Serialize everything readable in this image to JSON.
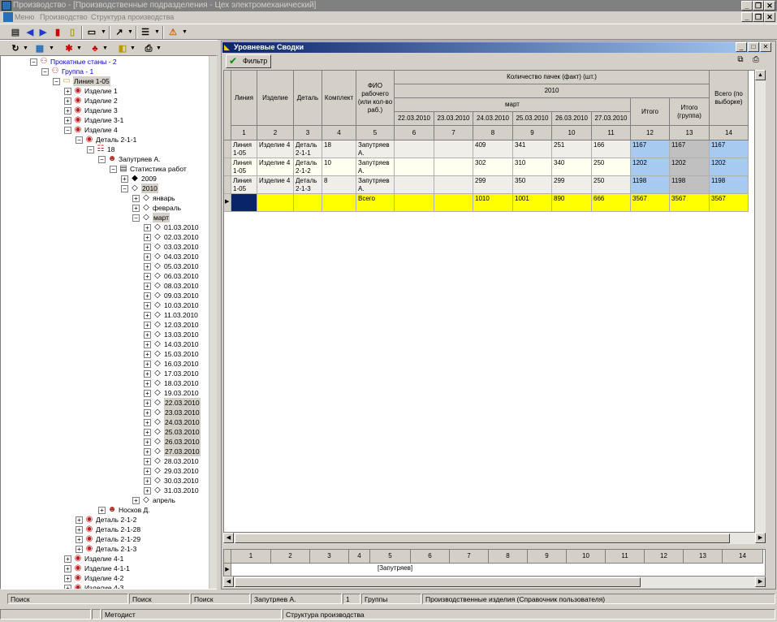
{
  "window": {
    "title": "Производство - [Производственные подразделения - Цех электромеханический]",
    "minimize": "_",
    "restore": "❐",
    "close": "✕"
  },
  "menu": {
    "items": [
      "Меню",
      "Производство",
      "Структура производства"
    ]
  },
  "tree": {
    "nodes": [
      {
        "label": "Прокатные станы - 2",
        "depth": 3,
        "icon": "org-icon",
        "exp": "-",
        "blue": true
      },
      {
        "label": "Группа - 1",
        "depth": 4,
        "icon": "org-icon",
        "exp": "-",
        "blue": true
      },
      {
        "label": "Линия 1-05",
        "depth": 5,
        "icon": "folder-icon",
        "exp": "-",
        "sel": true
      },
      {
        "label": "Изделие 1",
        "depth": 6,
        "icon": "product-icon",
        "exp": "+"
      },
      {
        "label": "Изделие 2",
        "depth": 6,
        "icon": "product-icon",
        "exp": "+"
      },
      {
        "label": "Изделие 3",
        "depth": 6,
        "icon": "product-icon",
        "exp": "+"
      },
      {
        "label": "Изделие 3-1",
        "depth": 6,
        "icon": "product-icon",
        "exp": "+"
      },
      {
        "label": "Изделие 4",
        "depth": 6,
        "icon": "product-icon",
        "exp": "-"
      },
      {
        "label": "Деталь 2-1-1",
        "depth": 7,
        "icon": "product-icon",
        "exp": "-"
      },
      {
        "label": "18",
        "depth": 8,
        "icon": "team-icon",
        "exp": "-"
      },
      {
        "label": "Запутряев А.",
        "depth": 9,
        "icon": "worker-icon",
        "exp": "-"
      },
      {
        "label": "Статистика работ",
        "depth": 10,
        "icon": "doc-icon",
        "exp": "-"
      },
      {
        "label": "2009",
        "depth": 11,
        "icon": "diamond-filled-icon",
        "exp": "+"
      },
      {
        "label": "2010",
        "depth": 11,
        "icon": "diamond-icon",
        "exp": "-",
        "sel": true
      },
      {
        "label": "январь",
        "depth": 12,
        "icon": "diamond-icon",
        "exp": "+"
      },
      {
        "label": "февраль",
        "depth": 12,
        "icon": "diamond-icon",
        "exp": "+"
      },
      {
        "label": "март",
        "depth": 12,
        "icon": "diamond-icon",
        "exp": "-",
        "sel": true
      },
      {
        "label": "01.03.2010",
        "depth": 13,
        "icon": "diamond-icon",
        "exp": "+"
      },
      {
        "label": "02.03.2010",
        "depth": 13,
        "icon": "diamond-icon",
        "exp": "+"
      },
      {
        "label": "03.03.2010",
        "depth": 13,
        "icon": "diamond-icon",
        "exp": "+"
      },
      {
        "label": "04.03.2010",
        "depth": 13,
        "icon": "diamond-icon",
        "exp": "+"
      },
      {
        "label": "05.03.2010",
        "depth": 13,
        "icon": "diamond-icon",
        "exp": "+"
      },
      {
        "label": "06.03.2010",
        "depth": 13,
        "icon": "diamond-icon",
        "exp": "+"
      },
      {
        "label": "08.03.2010",
        "depth": 13,
        "icon": "diamond-icon",
        "exp": "+"
      },
      {
        "label": "09.03.2010",
        "depth": 13,
        "icon": "diamond-icon",
        "exp": "+"
      },
      {
        "label": "10.03.2010",
        "depth": 13,
        "icon": "diamond-icon",
        "exp": "+"
      },
      {
        "label": "11.03.2010",
        "depth": 13,
        "icon": "diamond-icon",
        "exp": "+"
      },
      {
        "label": "12.03.2010",
        "depth": 13,
        "icon": "diamond-icon",
        "exp": "+"
      },
      {
        "label": "13.03.2010",
        "depth": 13,
        "icon": "diamond-icon",
        "exp": "+"
      },
      {
        "label": "14.03.2010",
        "depth": 13,
        "icon": "diamond-icon",
        "exp": "+"
      },
      {
        "label": "15.03.2010",
        "depth": 13,
        "icon": "diamond-icon",
        "exp": "+"
      },
      {
        "label": "16.03.2010",
        "depth": 13,
        "icon": "diamond-icon",
        "exp": "+"
      },
      {
        "label": "17.03.2010",
        "depth": 13,
        "icon": "diamond-icon",
        "exp": "+"
      },
      {
        "label": "18.03.2010",
        "depth": 13,
        "icon": "diamond-icon",
        "exp": "+"
      },
      {
        "label": "19.03.2010",
        "depth": 13,
        "icon": "diamond-icon",
        "exp": "+"
      },
      {
        "label": "22.03.2010",
        "depth": 13,
        "icon": "diamond-icon",
        "exp": "+",
        "sel": true
      },
      {
        "label": "23.03.2010",
        "depth": 13,
        "icon": "diamond-icon",
        "exp": "+",
        "sel": true
      },
      {
        "label": "24.03.2010",
        "depth": 13,
        "icon": "diamond-icon",
        "exp": "+",
        "sel": true
      },
      {
        "label": "25.03.2010",
        "depth": 13,
        "icon": "diamond-icon",
        "exp": "+",
        "sel": true
      },
      {
        "label": "26.03.2010",
        "depth": 13,
        "icon": "diamond-icon",
        "exp": "+",
        "sel": true
      },
      {
        "label": "27.03.2010",
        "depth": 13,
        "icon": "diamond-icon",
        "exp": "+",
        "sel": true
      },
      {
        "label": "28.03.2010",
        "depth": 13,
        "icon": "diamond-icon",
        "exp": "+"
      },
      {
        "label": "29.03.2010",
        "depth": 13,
        "icon": "diamond-icon",
        "exp": "+"
      },
      {
        "label": "30.03.2010",
        "depth": 13,
        "icon": "diamond-icon",
        "exp": "+"
      },
      {
        "label": "31.03.2010",
        "depth": 13,
        "icon": "diamond-icon",
        "exp": "+"
      },
      {
        "label": "апрель",
        "depth": 12,
        "icon": "diamond-icon",
        "exp": "+"
      },
      {
        "label": "Носков Д.",
        "depth": 9,
        "icon": "worker-icon",
        "exp": "+"
      },
      {
        "label": "Деталь 2-1-2",
        "depth": 7,
        "icon": "product-icon",
        "exp": "+"
      },
      {
        "label": "Деталь 2-1-28",
        "depth": 7,
        "icon": "product-icon",
        "exp": "+"
      },
      {
        "label": "Деталь 2-1-29",
        "depth": 7,
        "icon": "product-icon",
        "exp": "+"
      },
      {
        "label": "Деталь 2-1-3",
        "depth": 7,
        "icon": "product-icon",
        "exp": "+"
      },
      {
        "label": "Изделие 4-1",
        "depth": 6,
        "icon": "product-icon",
        "exp": "+"
      },
      {
        "label": "Изделие 4-1-1",
        "depth": 6,
        "icon": "product-icon",
        "exp": "+"
      },
      {
        "label": "Изделие 4-2",
        "depth": 6,
        "icon": "product-icon",
        "exp": "+"
      },
      {
        "label": "Изделие 4-3",
        "depth": 6,
        "icon": "product-icon",
        "exp": "+"
      }
    ]
  },
  "panel": {
    "title": "Уровневые Сводки",
    "filter_label": "Фильтр"
  },
  "grid": {
    "headers": {
      "line": "Линия",
      "product": "Изделие",
      "part": "Деталь",
      "kit": "Комплект",
      "worker": "ФИО рабочего (или кол-во раб.)",
      "qty": "Количество пачек (факт) (шт.)",
      "year": "2010",
      "month": "март",
      "dates": [
        "22.03.2010",
        "23.03.2010",
        "24.03.2010",
        "25.03.2010",
        "26.03.2010",
        "27.03.2010"
      ],
      "total": "Итого",
      "total_group": "Итого (группа)",
      "total_all": "Всего (по выборке)"
    },
    "col_numbers": [
      "1",
      "2",
      "3",
      "4",
      "5",
      "6",
      "7",
      "8",
      "9",
      "10",
      "11",
      "12",
      "13",
      "14"
    ],
    "rows": [
      [
        "Линия 1-05",
        "Изделие 4",
        "Деталь 2-1-1",
        "18",
        "Запутряев А.",
        "",
        "",
        "409",
        "341",
        "251",
        "166",
        "1167",
        "1167",
        "1167"
      ],
      [
        "Линия 1-05",
        "Изделие 4",
        "Деталь 2-1-2",
        "10",
        "Запутряев А.",
        "",
        "",
        "302",
        "310",
        "340",
        "250",
        "1202",
        "1202",
        "1202"
      ],
      [
        "Линия 1-05",
        "Изделие 4",
        "Деталь 2-1-3",
        "8",
        "Запутряев А.",
        "",
        "",
        "299",
        "350",
        "299",
        "250",
        "1198",
        "1198",
        "1198"
      ],
      [
        "",
        "",
        "",
        "",
        "Всего",
        "",
        "",
        "1010",
        "1001",
        "890",
        "666",
        "3567",
        "3567",
        "3567"
      ]
    ],
    "colors": {
      "yellow": "#ffff00",
      "blue_cell": "#a6caf0",
      "gray_cell": "#c0c0c0",
      "cursor": "#0a246a"
    }
  },
  "summary": {
    "col_numbers": [
      "1",
      "2",
      "3",
      "4",
      "5",
      "6",
      "7",
      "8",
      "9",
      "10",
      "11",
      "12",
      "13",
      "14"
    ],
    "worker": "[Запутряев]"
  },
  "statusbar": {
    "row1": [
      "Поиск",
      "Поиск",
      "Поиск",
      "Запутряев А.",
      "1",
      "Группы",
      "Производственные изделия (Справочник пользователя)"
    ],
    "row2": [
      "",
      "",
      "Методист",
      "Структура производства"
    ]
  }
}
